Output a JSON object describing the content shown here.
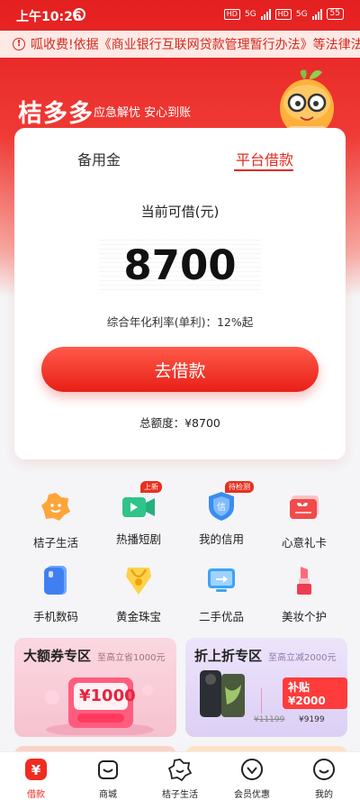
{
  "status": {
    "time": "上午10:26",
    "network_1": "5G",
    "network_2": "5G",
    "battery": "55"
  },
  "notice": {
    "text": "呱收费!依据《商业银行互联网贷款管理暂行办法》等法律法规"
  },
  "brand": {
    "name": "桔多多",
    "slogan": "应急解忧 安心到账"
  },
  "loan_card": {
    "tabs": [
      "备用金",
      "平台借款"
    ],
    "active_tab": "平台借款",
    "available_label": "当前可借(元)",
    "available_amount": "8700",
    "rate_text": "综合年化利率(单利)：12%起",
    "borrow_button": "去借款",
    "total_quota": "总额度：¥8700"
  },
  "services": [
    {
      "label": "桔子生活",
      "icon": "orange-life-icon",
      "tag": ""
    },
    {
      "label": "热播短剧",
      "icon": "video-play-icon",
      "tag": "上新"
    },
    {
      "label": "我的信用",
      "icon": "credit-shield-icon",
      "tag": "待检测"
    },
    {
      "label": "心意礼卡",
      "icon": "gift-card-icon",
      "tag": ""
    },
    {
      "label": "手机数码",
      "icon": "phone-icon",
      "tag": ""
    },
    {
      "label": "黄金珠宝",
      "icon": "necklace-icon",
      "tag": ""
    },
    {
      "label": "二手优品",
      "icon": "secondhand-monitor-icon",
      "tag": ""
    },
    {
      "label": "美妆个护",
      "icon": "lipstick-icon",
      "tag": ""
    }
  ],
  "promos": {
    "left": {
      "title": "大额券专区",
      "subtitle": "至高立省1000元",
      "coupon": "¥1000"
    },
    "right": {
      "title": "折上折专区",
      "subtitle": "至高立减2000元",
      "subsidy": "补贴¥2000",
      "old_price": "¥11199",
      "new_price": "¥9199"
    }
  },
  "tabbar": [
    {
      "label": "借款",
      "icon": "yuan-icon",
      "active": true
    },
    {
      "label": "商城",
      "icon": "shopping-bag-icon",
      "active": false
    },
    {
      "label": "桔子生活",
      "icon": "orange-smile-icon",
      "active": false
    },
    {
      "label": "会员优惠",
      "icon": "member-heart-icon",
      "active": false
    },
    {
      "label": "我的",
      "icon": "profile-smile-icon",
      "active": false
    }
  ],
  "colors": {
    "brand_red": "#e41f1f",
    "accent_red": "#e02a1e"
  }
}
